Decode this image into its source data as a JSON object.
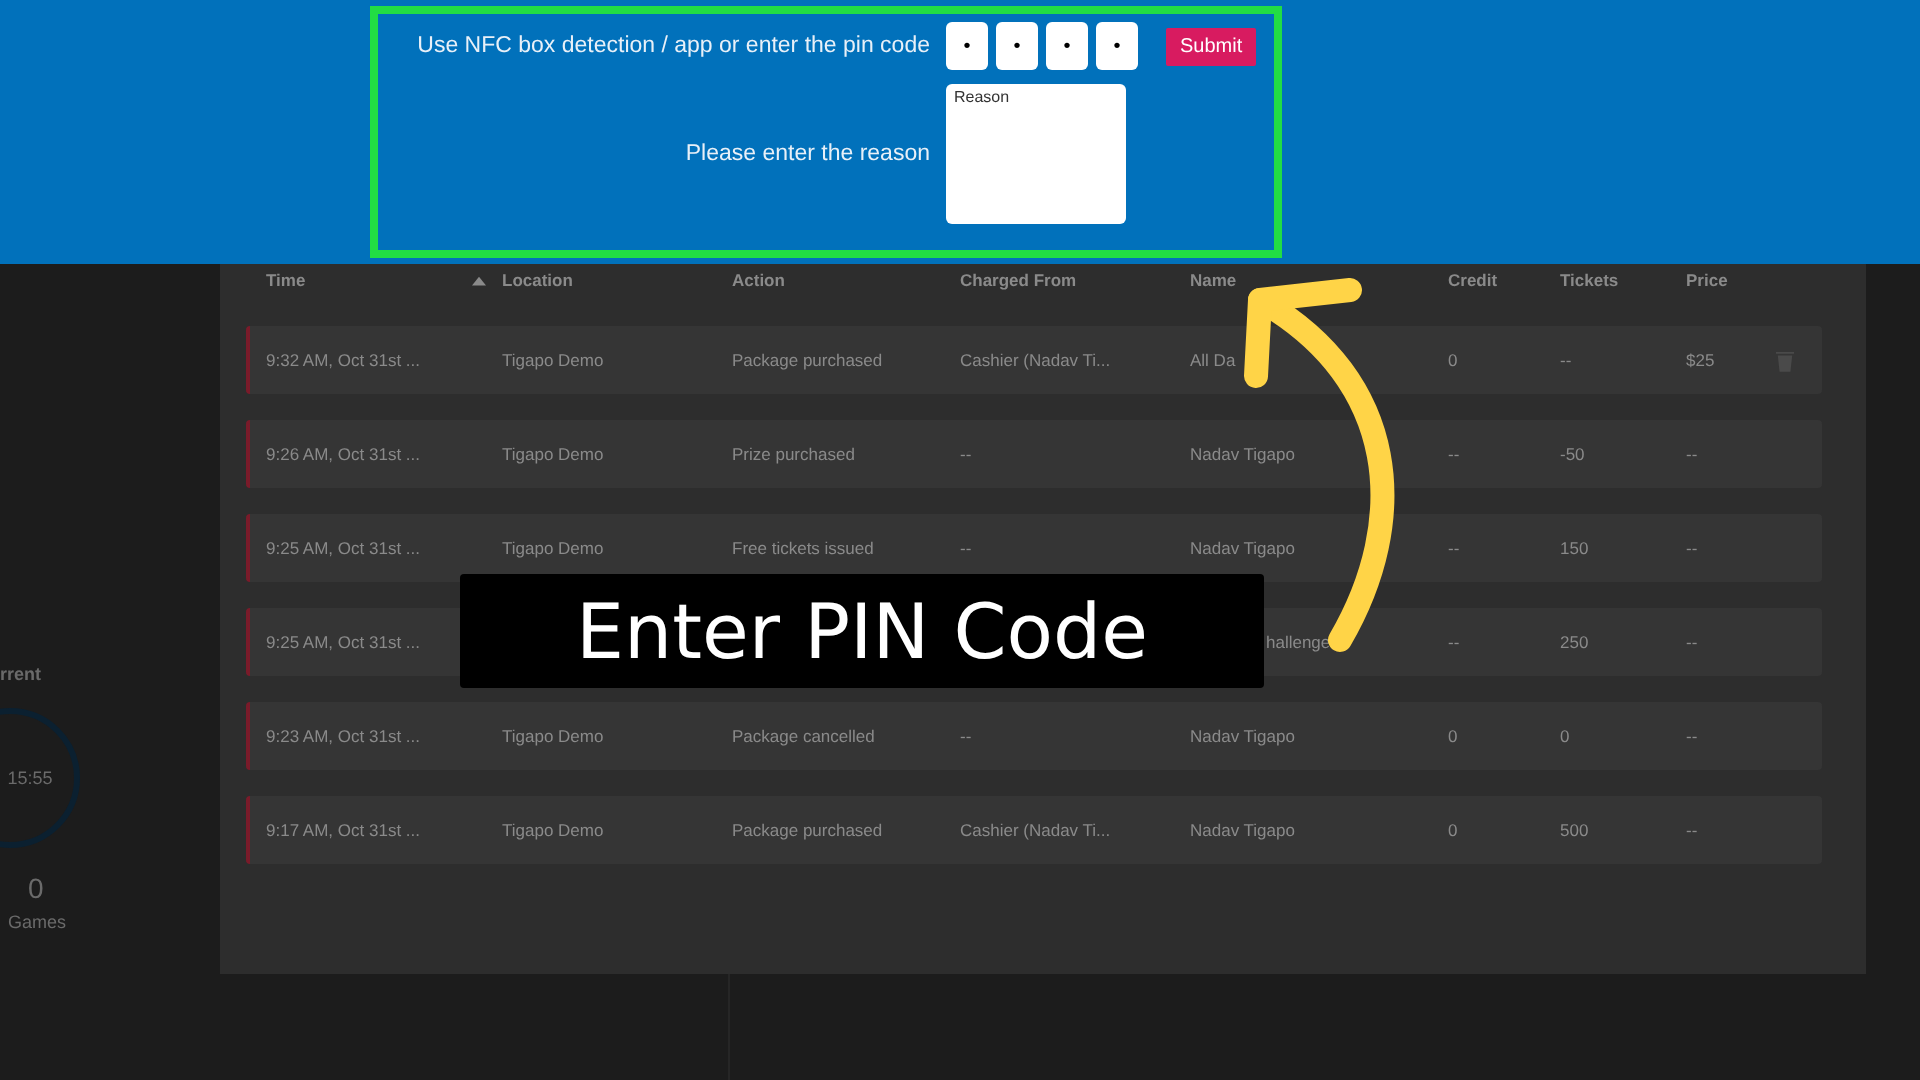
{
  "banner": {
    "pin_label": "Use NFC box detection / app or enter the pin code",
    "pin_digits": [
      "•",
      "•",
      "•",
      "•"
    ],
    "submit": "Submit",
    "reason_label": "Please enter the reason",
    "reason_placeholder": "Reason"
  },
  "sidebar": {
    "title": "rrent",
    "timer": "15:55",
    "count": "0",
    "count_label": "Games"
  },
  "table": {
    "columns": [
      {
        "label": "Time",
        "sorted": true
      },
      {
        "label": "Location",
        "sorted": false
      },
      {
        "label": "Action",
        "sorted": false
      },
      {
        "label": "Charged From",
        "sorted": false
      },
      {
        "label": "Name",
        "sorted": false
      },
      {
        "label": "Credit",
        "sorted": false
      },
      {
        "label": "Tickets",
        "sorted": false
      },
      {
        "label": "Price",
        "sorted": false
      }
    ],
    "rows": [
      {
        "time": "9:32 AM, Oct 31st ...",
        "location": "Tigapo Demo",
        "action": "Package purchased",
        "charged_from": "Cashier (Nadav Ti...",
        "name": "All Da",
        "credit": "0",
        "tickets": "--",
        "price": "$25",
        "deletable": true
      },
      {
        "time": "9:26 AM, Oct 31st ...",
        "location": "Tigapo Demo",
        "action": "Prize purchased",
        "charged_from": "--",
        "name": "Nadav Tigapo",
        "credit": "--",
        "tickets": "-50",
        "price": "--",
        "deletable": false
      },
      {
        "time": "9:25 AM, Oct 31st ...",
        "location": "Tigapo Demo",
        "action": "Free tickets issued",
        "charged_from": "--",
        "name": "Nadav Tigapo",
        "credit": "--",
        "tickets": "150",
        "price": "--",
        "deletable": false
      },
      {
        "time": "9:25 AM, Oct 31st ...",
        "name": "hallenge",
        "credit": "--",
        "tickets": "250",
        "price": "--",
        "deletable": false
      },
      {
        "time": "9:23 AM, Oct 31st ...",
        "location": "Tigapo Demo",
        "action": "Package cancelled",
        "charged_from": "--",
        "name": "Nadav Tigapo",
        "credit": "0",
        "tickets": "0",
        "price": "--",
        "deletable": false
      },
      {
        "time": "9:17 AM, Oct 31st ...",
        "location": "Tigapo Demo",
        "action": "Package purchased",
        "charged_from": "Cashier (Nadav Ti...",
        "name": "Nadav Tigapo",
        "credit": "0",
        "tickets": "500",
        "price": "--",
        "deletable": false
      }
    ]
  },
  "callout": {
    "text": "Enter PIN Code"
  }
}
